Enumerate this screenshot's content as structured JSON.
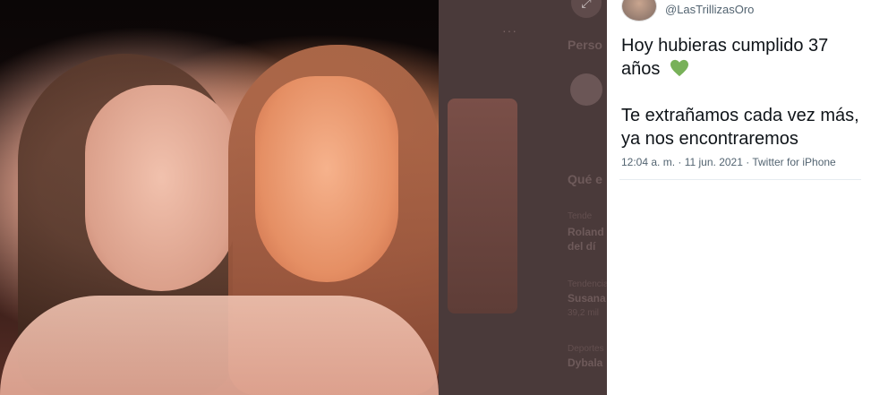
{
  "photo": {
    "alt": ""
  },
  "background": {
    "section_title_1": "Perso",
    "section_title_2": "Qué e",
    "trend_1_context": "Tende",
    "trend_1_name": "Roland",
    "trend_1_sub": "del dí",
    "trend_2_context": "Tendencia",
    "trend_2_name": "Susana",
    "trend_2_count": "39,2 mil",
    "trend_3_context": "Deportes",
    "trend_3_name": "Dybala",
    "more_dots": "···"
  },
  "tweet": {
    "handle": "@LasTrillizasOro",
    "line1": "Hoy hubieras cumplido 37",
    "line2": "años",
    "line3": "Te extrañamos cada vez más,",
    "line4": "ya nos encontraremos",
    "time": "12:04 a. m.",
    "separator": " · ",
    "date": "11 jun. 2021",
    "source": "Twitter for iPhone"
  },
  "icons": {
    "heart": "green-heart-icon",
    "expand": "expand-icon"
  },
  "colors": {
    "heart": "#78b159",
    "text": "#0f1419",
    "muted": "#536471"
  }
}
